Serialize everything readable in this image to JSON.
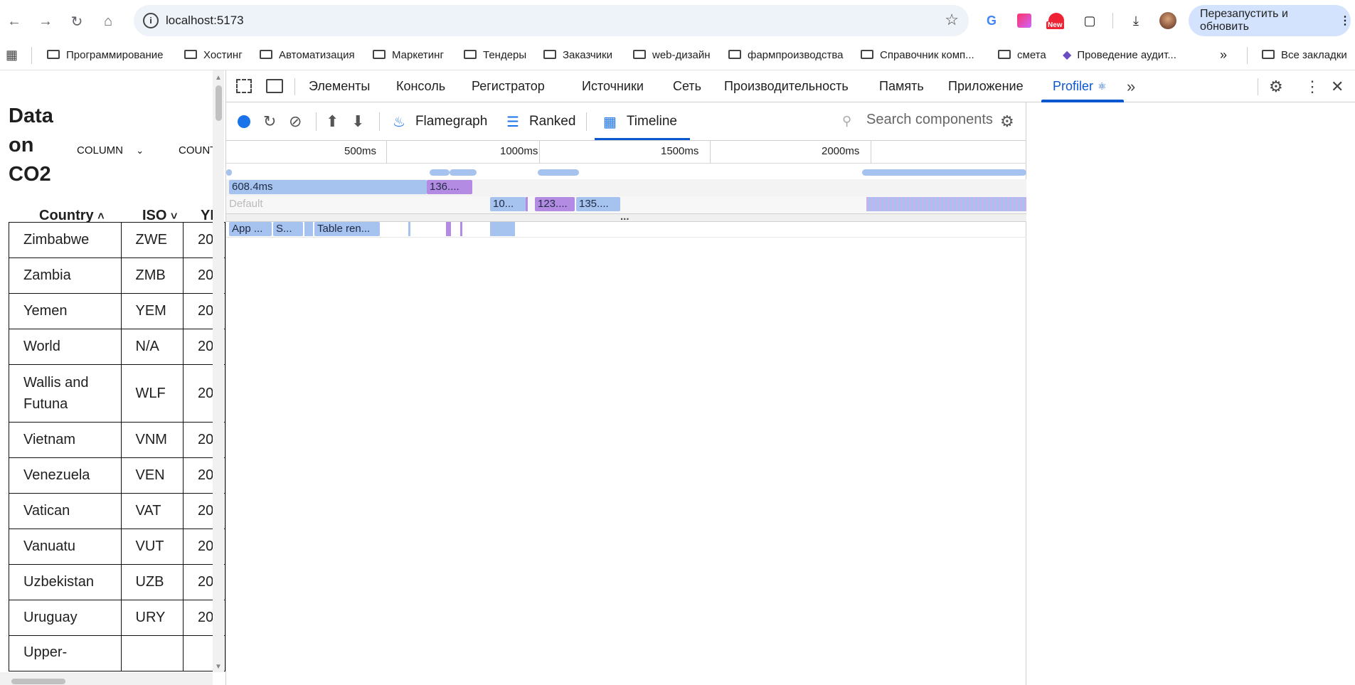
{
  "browser": {
    "url": "localhost:5173",
    "relaunch_label": "Перезапустить и обновить",
    "ext_new_badge": "New"
  },
  "bookmarks": {
    "items": [
      "Программирование",
      "Хостинг",
      "Автоматизация",
      "Маркетинг",
      "Тендеры",
      "Заказчики",
      "web-дизайн",
      "фармпроизводства",
      "Справочник комп...",
      "смета",
      "Проведение аудит..."
    ],
    "overflow": "»",
    "all": "Все закладки"
  },
  "page": {
    "title": "Data on CO2",
    "title_lines": [
      "Data",
      "on",
      "CO2"
    ],
    "column_control": "COLUMN",
    "count_control": "COUNT",
    "headers": {
      "country": "Country",
      "iso": "ISO",
      "year": "YI"
    },
    "rows": [
      {
        "country": "Zimbabwe",
        "iso": "ZWE",
        "year": "20"
      },
      {
        "country": "Zambia",
        "iso": "ZMB",
        "year": "20"
      },
      {
        "country": "Yemen",
        "iso": "YEM",
        "year": "20"
      },
      {
        "country": "World",
        "iso": "N/A",
        "year": "20"
      },
      {
        "country": "Wallis and Futuna",
        "iso": "WLF",
        "year": "20"
      },
      {
        "country": "Vietnam",
        "iso": "VNM",
        "year": "20"
      },
      {
        "country": "Venezuela",
        "iso": "VEN",
        "year": "20"
      },
      {
        "country": "Vatican",
        "iso": "VAT",
        "year": "20"
      },
      {
        "country": "Vanuatu",
        "iso": "VUT",
        "year": "20"
      },
      {
        "country": "Uzbekistan",
        "iso": "UZB",
        "year": "20"
      },
      {
        "country": "Uruguay",
        "iso": "URY",
        "year": "20"
      },
      {
        "country": "Upper-",
        "iso": "",
        "year": ""
      }
    ]
  },
  "devtools": {
    "tabs": [
      "Элементы",
      "Консоль",
      "Регистратор",
      "Источники",
      "Сеть",
      "Производительность",
      "Память",
      "Приложение",
      "Profiler"
    ],
    "active_tab": "Profiler",
    "profiler": {
      "flamegraph": "Flamegraph",
      "ranked": "Ranked",
      "timeline": "Timeline",
      "search_placeholder": "Search components",
      "ticks": [
        "500ms",
        "1000ms",
        "1500ms",
        "2000ms"
      ],
      "bars": {
        "b1": "608.4ms",
        "b2": "136....",
        "default": "Default",
        "b3": "10...",
        "b4": "123....",
        "b5": "135....",
        "ellipsis": "...",
        "c1": "App ...",
        "c2": "S...",
        "c3": "Table ren..."
      }
    }
  },
  "colors": {
    "accent": "#0b57d0",
    "blue_bar": "#a6c3ef",
    "purple_bar": "#b38be3",
    "record": "#1a73e8"
  }
}
